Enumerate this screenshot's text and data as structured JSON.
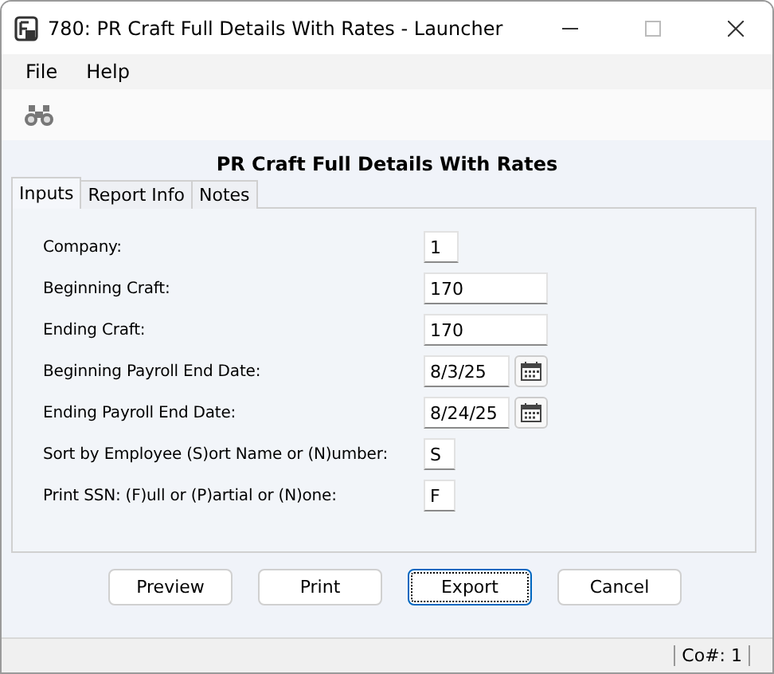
{
  "window": {
    "title": "780: PR Craft Full Details With Rates - Launcher"
  },
  "menu": [
    "File",
    "Help"
  ],
  "heading": "PR Craft Full Details With Rates",
  "tabs": [
    {
      "label": "Inputs",
      "selected": true
    },
    {
      "label": "Report Info",
      "selected": false
    },
    {
      "label": "Notes",
      "selected": false
    }
  ],
  "fields": [
    {
      "label": "Company:",
      "value": "1",
      "kind": "short"
    },
    {
      "label": "Beginning Craft:",
      "value": "170",
      "kind": "wide"
    },
    {
      "label": "Ending Craft:",
      "value": "170",
      "kind": "wide"
    },
    {
      "label": "Beginning Payroll End Date:",
      "value": "8/3/25",
      "kind": "date"
    },
    {
      "label": "Ending Payroll End Date:",
      "value": "8/24/25",
      "kind": "date"
    },
    {
      "label": "Sort by Employee (S)ort Name or (N)umber:",
      "value": "S",
      "kind": "letter"
    },
    {
      "label": "Print SSN: (F)ull or (P)artial or (N)one:",
      "value": "F",
      "kind": "letter"
    }
  ],
  "buttons": [
    {
      "label": "Preview",
      "focused": false
    },
    {
      "label": "Print",
      "focused": false
    },
    {
      "label": "Export",
      "focused": true
    },
    {
      "label": "Cancel",
      "focused": false
    }
  ],
  "status_bar": {
    "company": "Co#: 1"
  }
}
